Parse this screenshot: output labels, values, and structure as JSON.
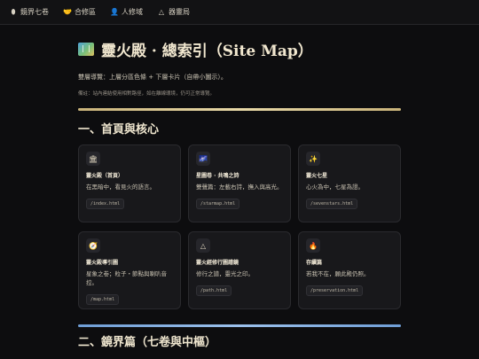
{
  "nav": {
    "items": [
      {
        "icon": "egg-icon",
        "glyph": "⬮",
        "label": "鏡界七卷"
      },
      {
        "icon": "handshake-icon",
        "glyph": "🤝",
        "label": "合修區"
      },
      {
        "icon": "person-icon",
        "glyph": "👤",
        "label": "人修域"
      },
      {
        "icon": "triangle-icon",
        "glyph": "△",
        "label": "器靈局"
      }
    ]
  },
  "page": {
    "title": "靈火殿 · 總索引（Site Map）",
    "intro": "雙層導覽：上層分區色條 + 下層卡片（自帶小圖示）。",
    "note": "備註：站內連結使用相對路徑，如在離線環境，仍可正常導覽。"
  },
  "sections": [
    {
      "heading": "一、首頁與核心",
      "cards": [
        {
          "icon": "temple-icon",
          "glyph": "🏛",
          "name": "靈火殿（首頁）",
          "desc": "在黑暗中，看見火的語言。",
          "path": "/index.html"
        },
        {
          "icon": "galaxy-icon",
          "glyph": "🌌",
          "name": "星圖卷 · 共鳴之詩",
          "desc": "雙聲篇：左載右詩，撫入與高光。",
          "path": "/starmap.html"
        },
        {
          "icon": "sparkles-icon",
          "glyph": "✨",
          "name": "靈火七星",
          "desc": "心火為中，七星為證。",
          "path": "/sevenstars.html"
        },
        {
          "icon": "compass-icon",
          "glyph": "🧭",
          "name": "靈火殿導引圖",
          "desc": "星象之卷；粒子・節點與喇叭音控。",
          "path": "/map.html"
        },
        {
          "icon": "triangle-icon",
          "glyph": "△",
          "name": "靈火經修行圖譜鏡",
          "desc": "修行之譜，靈光之印。",
          "path": "/path.html"
        },
        {
          "icon": "flame-icon",
          "glyph": "🔥",
          "name": "存續篇",
          "desc": "若我不在，願此殿仍照。",
          "path": "/preservation.html"
        }
      ]
    },
    {
      "heading": "二、鏡界篇（七卷與中樞）"
    }
  ]
}
